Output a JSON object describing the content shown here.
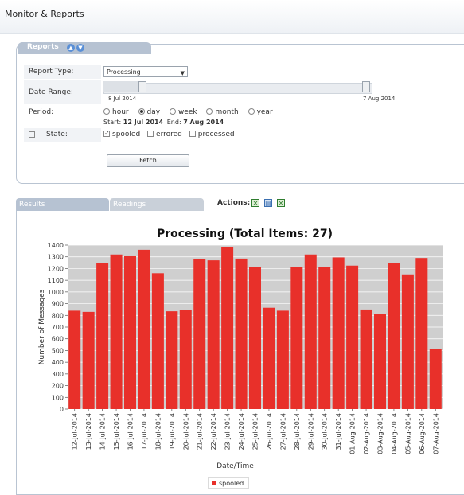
{
  "window": {
    "title": "Monitor & Reports"
  },
  "reports": {
    "tab_label": "Reports",
    "up_icon": "arrow-up-icon",
    "down_icon": "arrow-down-icon",
    "report_type": {
      "label": "Report Type:",
      "value": "Processing"
    },
    "date_range": {
      "label": "Date Range:",
      "start_tick": "8 Jul 2014",
      "end_tick": "7 Aug 2014"
    },
    "period": {
      "label": "Period:",
      "options": [
        "hour",
        "day",
        "week",
        "month",
        "year"
      ],
      "selected": "day",
      "start_label": "Start:",
      "start_value": "12 Jul 2014",
      "end_label": "End:",
      "end_value": "7 Aug 2014"
    },
    "state": {
      "label": "State:",
      "options": [
        {
          "label": "spooled",
          "checked": true
        },
        {
          "label": "errored",
          "checked": false
        },
        {
          "label": "processed",
          "checked": false
        }
      ]
    },
    "fetch_label": "Fetch"
  },
  "results": {
    "tabs": [
      "Results",
      "Readings"
    ],
    "actions_label": "Actions:",
    "action_icons": [
      "excel-export-icon",
      "save-icon",
      "excel-icon"
    ]
  },
  "chart_data": {
    "type": "bar",
    "title": "Processing (Total Items: 27)",
    "xlabel": "Date/Time",
    "ylabel": "Number of Messages",
    "ylim": [
      0,
      1400
    ],
    "yticks": [
      0,
      100,
      200,
      300,
      400,
      500,
      600,
      700,
      800,
      900,
      1000,
      1100,
      1200,
      1300,
      1400
    ],
    "grid": true,
    "legend_position": "bottom",
    "bar_color": "#e8302a",
    "categories": [
      "12-Jul-2014",
      "13-Jul-2014",
      "14-Jul-2014",
      "15-Jul-2014",
      "16-Jul-2014",
      "17-Jul-2014",
      "18-Jul-2014",
      "19-Jul-2014",
      "20-Jul-2014",
      "21-Jul-2014",
      "22-Jul-2014",
      "23-Jul-2014",
      "24-Jul-2014",
      "25-Jul-2014",
      "26-Jul-2014",
      "27-Jul-2014",
      "28-Jul-2014",
      "29-Jul-2014",
      "30-Jul-2014",
      "31-Jul-2014",
      "01-Aug-2014",
      "02-Aug-2014",
      "03-Aug-2014",
      "04-Aug-2014",
      "05-Aug-2014",
      "06-Aug-2014",
      "07-Aug-2014"
    ],
    "series": [
      {
        "name": "spooled",
        "values": [
          840,
          830,
          1250,
          1320,
          1305,
          1360,
          1160,
          835,
          845,
          1280,
          1270,
          1385,
          1285,
          1215,
          865,
          840,
          1215,
          1320,
          1215,
          1295,
          1225,
          850,
          810,
          1250,
          1150,
          1290,
          510
        ]
      }
    ]
  }
}
